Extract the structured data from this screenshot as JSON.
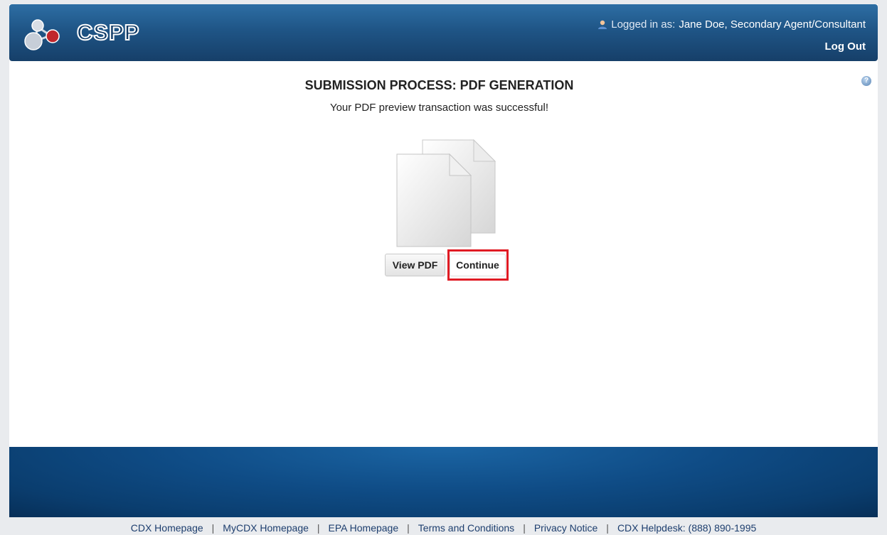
{
  "header": {
    "logo_text": "CSPP",
    "logged_in_prefix": "Logged in as:",
    "user_name": "Jane Doe, Secondary Agent/Consultant",
    "logout_label": "Log Out"
  },
  "main": {
    "title": "SUBMISSION PROCESS: PDF GENERATION",
    "message": "Your PDF preview transaction was successful!",
    "view_pdf_label": "View PDF",
    "continue_label": "Continue",
    "help_symbol": "?"
  },
  "footer": {
    "links": [
      "CDX Homepage",
      "MyCDX Homepage",
      "EPA Homepage",
      "Terms and Conditions",
      "Privacy Notice",
      "CDX Helpdesk: (888) 890-1995"
    ],
    "separator": "|"
  },
  "colors": {
    "header_blue": "#1f5586",
    "highlight_red": "#e01b24",
    "footer_blue": "#0f4c86"
  },
  "icons": [
    "molecule-logo-icon",
    "user-icon",
    "help-icon",
    "documents-icon"
  ]
}
